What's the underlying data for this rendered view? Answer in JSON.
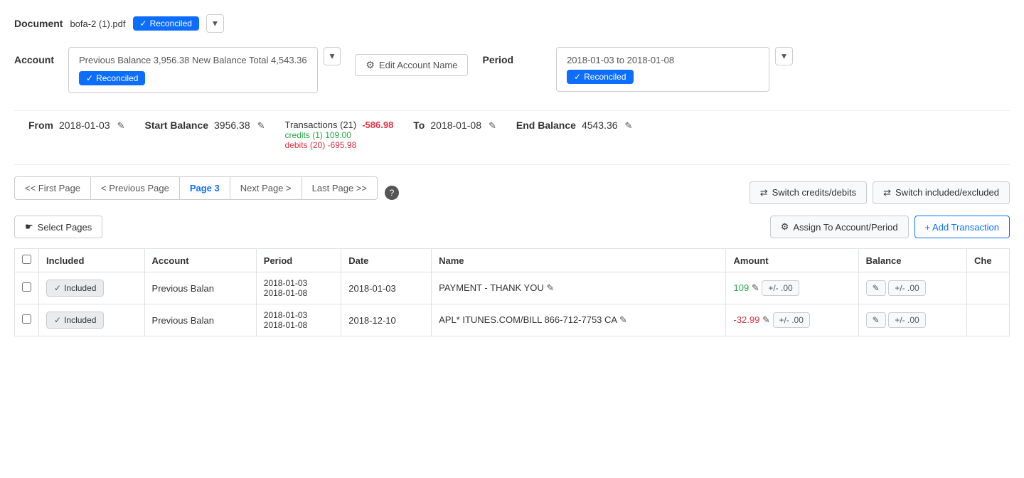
{
  "document": {
    "label": "Document",
    "filename": "bofa-2 (1).pdf",
    "badge": "Reconciled",
    "chevron": "▾"
  },
  "account": {
    "label": "Account",
    "box_text": "Previous Balance 3,956.38 New Balance Total 4,543.36",
    "badge": "Reconciled",
    "edit_btn": "Edit Account Name",
    "chevron": "▾"
  },
  "period": {
    "label": "Period",
    "dates": "2018-01-03 to 2018-01-08",
    "badge": "Reconciled",
    "chevron": "▾"
  },
  "stats": {
    "from_label": "From",
    "from_date": "2018-01-03",
    "start_balance_label": "Start Balance",
    "start_balance": "3956.38",
    "transactions_label": "Transactions (21)",
    "transactions_value": "-586.98",
    "credits": "credits (1) 109.00",
    "debits": "debits (20) -695.98",
    "to_label": "To",
    "to_date": "2018-01-08",
    "end_balance_label": "End Balance",
    "end_balance": "4543.36"
  },
  "pagination": {
    "first_page": "<< First Page",
    "prev_page": "< Previous Page",
    "current_page": "Page 3",
    "next_page": "Next Page >",
    "last_page": "Last Page >>"
  },
  "action_buttons": {
    "switch_credits": "Switch credits/debits",
    "switch_included": "Switch included/excluded"
  },
  "bottom_actions": {
    "select_pages": "Select Pages",
    "assign_btn": "Assign To Account/Period",
    "add_transaction": "+ Add Transaction"
  },
  "table": {
    "headers": [
      "",
      "Included",
      "Account",
      "Period",
      "Date",
      "Name",
      "Amount",
      "Balance",
      "Che"
    ],
    "rows": [
      {
        "included": "Included",
        "account": "Previous Balan",
        "period": "2018-01-03\n2018-01-08",
        "date": "2018-01-03",
        "name": "PAYMENT - THANK YOU",
        "amount": "109",
        "amount_class": "amount-positive",
        "balance": "",
        "balance_val": ".00"
      },
      {
        "included": "Included",
        "account": "Previous Balan",
        "period": "2018-01-03\n2018-01-08",
        "date": "2018-12-10",
        "name": "APL* ITUNES.COM/BILL 866-712-7753 CA",
        "amount": "-32.99",
        "amount_class": "amount-negative",
        "balance": "",
        "balance_val": ".00"
      }
    ]
  },
  "icons": {
    "edit_pencil": "✎",
    "gear": "⚙",
    "hand": "☛",
    "switch": "⇄",
    "plus": "+",
    "check": "✓",
    "external_link": "✎"
  }
}
